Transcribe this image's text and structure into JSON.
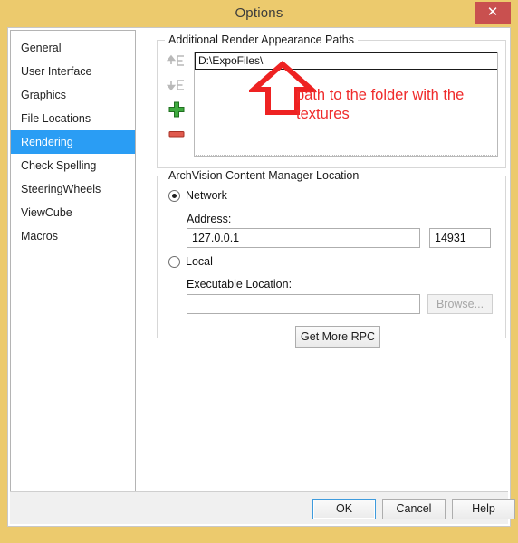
{
  "window": {
    "title": "Options",
    "close_label": "✕",
    "frame_color": "#ecca6d",
    "close_color": "#c9504f"
  },
  "sidebar": {
    "selected_index": 4,
    "selection_color": "#2a9df4",
    "items": [
      {
        "label": "General"
      },
      {
        "label": "User Interface"
      },
      {
        "label": "Graphics"
      },
      {
        "label": "File Locations"
      },
      {
        "label": "Rendering"
      },
      {
        "label": "Check Spelling"
      },
      {
        "label": "SteeringWheels"
      },
      {
        "label": "ViewCube"
      },
      {
        "label": "Macros"
      }
    ]
  },
  "render_paths": {
    "group_title": "Additional Render Appearance Paths",
    "tools": [
      {
        "icon": "move-up-icon",
        "enabled": false
      },
      {
        "icon": "move-down-icon",
        "enabled": false
      },
      {
        "icon": "add-icon",
        "enabled": true
      },
      {
        "icon": "remove-icon",
        "enabled": true
      }
    ],
    "entries": [
      {
        "value": "D:\\ExpoFiles\\"
      }
    ]
  },
  "annotation": {
    "text": "path to the folder with the textures",
    "color": "#ef2b2b",
    "arrow": "up-arrow-annotation"
  },
  "archvision": {
    "group_title": "ArchVision Content Manager Location",
    "network": {
      "label": "Network",
      "label_accel": "N",
      "selected": true,
      "address_label": "Address:",
      "address_value": "127.0.0.1",
      "port_value": "14931"
    },
    "local": {
      "label": "Local",
      "label_accel": "L",
      "selected": false,
      "executable_label": "Executable Location:",
      "executable_label_accel": "E",
      "executable_value": "",
      "browse_label": "Browse...",
      "browse_accel": "B",
      "browse_enabled": false
    },
    "get_more_label": "Get More RPC",
    "get_more_accel": "G"
  },
  "footer": {
    "ok_label": "OK",
    "cancel_label": "Cancel",
    "help_label": "Help"
  }
}
